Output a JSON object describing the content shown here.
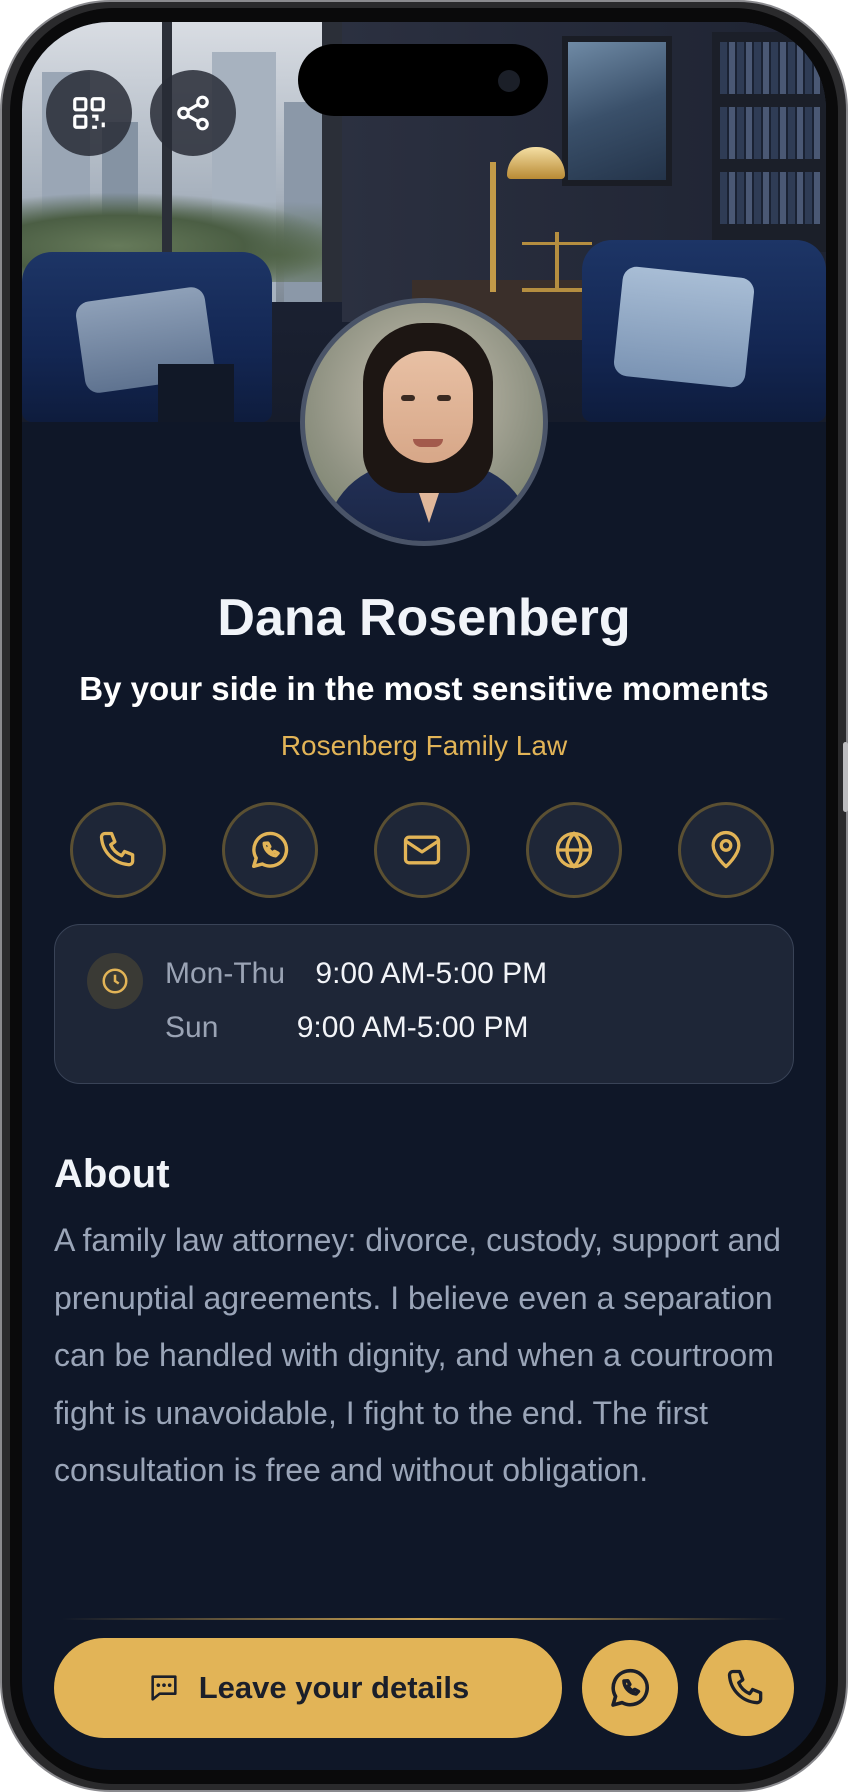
{
  "profile": {
    "name": "Dana Rosenberg",
    "tagline": "By your side in the most sensitive moments",
    "company": "Rosenberg Family Law"
  },
  "top_actions": [
    {
      "icon": "qr-code-icon"
    },
    {
      "icon": "share-icon"
    }
  ],
  "contact_actions": [
    {
      "icon": "phone-icon"
    },
    {
      "icon": "whatsapp-icon"
    },
    {
      "icon": "mail-icon"
    },
    {
      "icon": "globe-icon"
    },
    {
      "icon": "map-pin-icon"
    }
  ],
  "hours": [
    {
      "days": "Mon-Thu",
      "time": "9:00 AM-5:00 PM"
    },
    {
      "days": "Sun",
      "time": "9:00 AM-5:00 PM"
    }
  ],
  "about": {
    "title": "About",
    "text": "A family law attorney: divorce, custody, support and prenuptial agreements. I believe even a separation can be handled with dignity, and when a courtroom fight is unavoidable, I fight to the end. The first consultation is free and without obligation."
  },
  "footer": {
    "lead_label": "Leave your details",
    "lead_icon": "chat-icon",
    "whatsapp_icon": "whatsapp-icon",
    "phone_icon": "phone-icon"
  },
  "colors": {
    "background": "#0f1728",
    "accent": "#e2b457",
    "card": "#1e2637"
  }
}
